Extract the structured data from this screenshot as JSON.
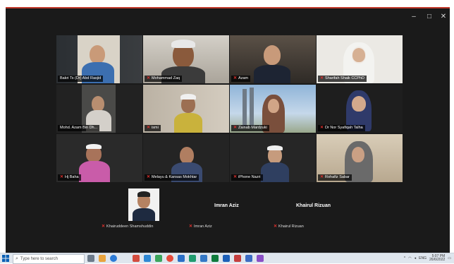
{
  "window": {
    "controls": {
      "minimize": "–",
      "maximize": "□",
      "close": "✕"
    }
  },
  "participants": [
    {
      "name": "Bakri Ts (Dr) Abd Rasjid",
      "muted": false,
      "active": true
    },
    {
      "name": "Mohammad Zaq",
      "muted": true
    },
    {
      "name": "Azam",
      "muted": true
    },
    {
      "name": "Sharifah Shaik CCPhD",
      "muted": true
    },
    {
      "name": "Mohd. Azam Bin Dh...",
      "muted": false
    },
    {
      "name": "ismi",
      "muted": true
    },
    {
      "name": "Zainab Mardzuki",
      "muted": true
    },
    {
      "name": "Dr Nor Syafiqah Talha",
      "muted": true
    },
    {
      "name": "Hj Baha",
      "muted": true
    },
    {
      "name": "Melayu & Kansas Mokhtar",
      "muted": true
    },
    {
      "name": "iPhone Nazri",
      "muted": true
    },
    {
      "name": "Rohafiz Sabar",
      "muted": true
    }
  ],
  "audio_only": [
    {
      "display": "",
      "tag": "Khairuddeen Shamshuddin"
    },
    {
      "display": "Imran Aziz",
      "tag": "Imran Aziz"
    },
    {
      "display": "Khairul Rizuan",
      "tag": "Khairul Rizuan"
    }
  ],
  "taskbar": {
    "search_placeholder": "Type here to search",
    "tray_text": "ENG",
    "time": "5:07 PM",
    "date": "26/6/2022"
  },
  "colors": {
    "active_speaker": "#2ed36b",
    "muted_icon": "#e2312d",
    "window_bg": "#1a1a1a"
  }
}
